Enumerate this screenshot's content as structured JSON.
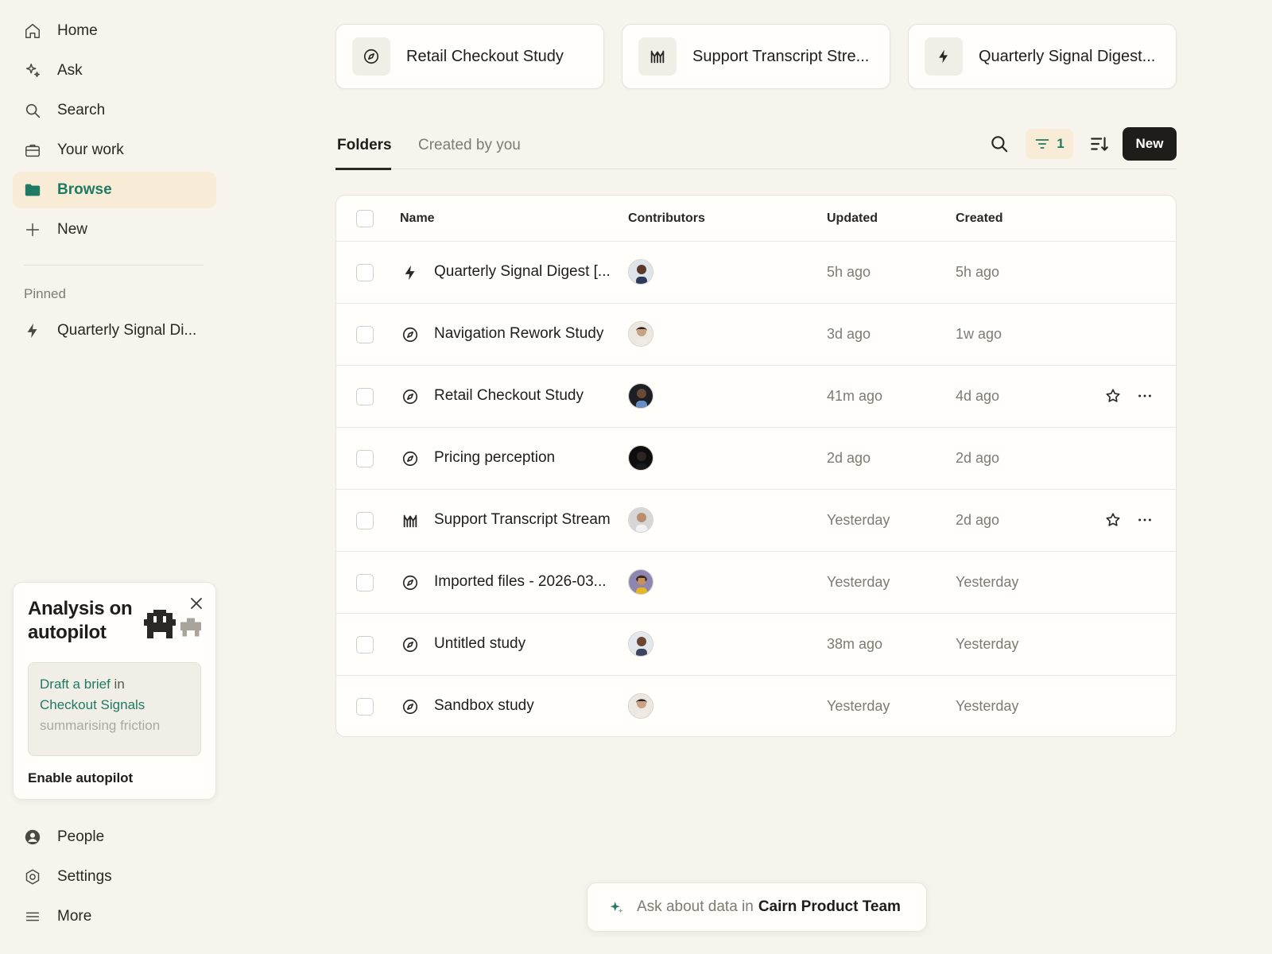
{
  "sidebar": {
    "nav": [
      {
        "label": "Home",
        "icon": "home-icon"
      },
      {
        "label": "Ask",
        "icon": "sparkles-icon"
      },
      {
        "label": "Search",
        "icon": "search-icon"
      },
      {
        "label": "Your work",
        "icon": "briefcase-icon"
      },
      {
        "label": "Browse",
        "icon": "folder-icon",
        "active": true
      },
      {
        "label": "New",
        "icon": "plus-icon"
      }
    ],
    "pinned_title": "Pinned",
    "pinned": [
      {
        "label": "Quarterly Signal Di...",
        "icon": "bolt-icon"
      }
    ],
    "promo": {
      "title": "Analysis on autopilot",
      "draft_green1": "Draft a brief",
      "draft_mid": " in",
      "draft_green2": "Checkout Signals",
      "draft_faded": "summarising friction",
      "enable": "Enable autopilot"
    },
    "bottom": [
      {
        "label": "People",
        "icon": "person-icon"
      },
      {
        "label": "Settings",
        "icon": "gear-icon"
      },
      {
        "label": "More",
        "icon": "menu-icon"
      }
    ]
  },
  "quick_access": [
    {
      "label": "Retail Checkout Study",
      "icon": "compass-icon"
    },
    {
      "label": "Support Transcript Stre...",
      "icon": "stream-icon"
    },
    {
      "label": "Quarterly Signal Digest...",
      "icon": "bolt-icon"
    }
  ],
  "tabs": {
    "folders": "Folders",
    "created": "Created by you"
  },
  "toolbar": {
    "filter_count": "1",
    "new_label": "New"
  },
  "table": {
    "headers": {
      "name": "Name",
      "contributors": "Contributors",
      "updated": "Updated",
      "created": "Created"
    },
    "rows": [
      {
        "name": "Quarterly Signal Digest [...",
        "icon": "bolt-icon",
        "updated": "5h ago",
        "created": "5h ago",
        "actions": false
      },
      {
        "name": "Navigation Rework Study",
        "icon": "compass-icon",
        "updated": "3d ago",
        "created": "1w ago",
        "actions": false
      },
      {
        "name": "Retail Checkout Study",
        "icon": "compass-icon",
        "updated": "41m ago",
        "created": "4d ago",
        "actions": true
      },
      {
        "name": "Pricing perception",
        "icon": "compass-icon",
        "updated": "2d ago",
        "created": "2d ago",
        "actions": false
      },
      {
        "name": "Support Transcript Stream",
        "icon": "stream-icon",
        "updated": "Yesterday",
        "created": "2d ago",
        "actions": true
      },
      {
        "name": "Imported files - 2026-03...",
        "icon": "compass-icon",
        "updated": "Yesterday",
        "created": "Yesterday",
        "actions": false
      },
      {
        "name": "Untitled study",
        "icon": "compass-icon",
        "updated": "38m ago",
        "created": "Yesterday",
        "actions": false
      },
      {
        "name": "Sandbox study",
        "icon": "compass-icon",
        "updated": "Yesterday",
        "created": "Yesterday",
        "actions": false
      }
    ]
  },
  "askbar": {
    "prefix": "Ask about data in",
    "workspace": "Cairn Product Team"
  },
  "colors": {
    "accent": "#1e7a64",
    "active_bg": "#f8ecd6",
    "background": "#f7f4ee",
    "primary_button": "#1f1d1a"
  }
}
